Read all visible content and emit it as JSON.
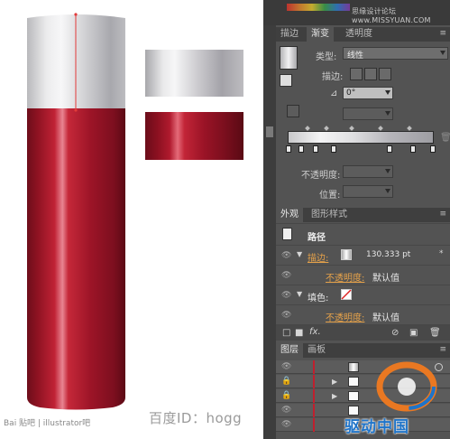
{
  "canvas": {
    "caption": "百度ID：hogg",
    "watermark": "Bai 贴吧 | illustrator吧"
  },
  "panel": {
    "site": "思缘设计论坛 www.MISSYUAN.COM",
    "gradient_tabs": [
      "描边",
      "渐变",
      "透明度"
    ],
    "active_gradient_tab": "渐变",
    "type_label": "类型:",
    "type_value": "线性",
    "stroke_label": "描边:",
    "angle_value": "0°",
    "opacity_label": "不透明度:",
    "position_label": "位置:",
    "appearance_tabs": [
      "外观",
      "图形样式"
    ],
    "active_appearance_tab": "外观",
    "path_label": "路径",
    "stroke_row_label": "描边:",
    "stroke_row_value": "130.333 pt",
    "opacity_row_label": "不透明度:",
    "opacity_row_value": "默认值",
    "fill_row_label": "填色:",
    "opacity_row2_label": "不透明度:",
    "opacity_row2_value": "默认值",
    "layers_tabs": [
      "图层",
      "画板"
    ],
    "active_layers_tab": "图层",
    "fx_label": "fx."
  },
  "overlay_logo": {
    "text": "驱动中国"
  },
  "colors": {
    "panel_bg": "#535353",
    "accent_orange": "#e6a24a",
    "bottle_red": "#9a1326",
    "logo_blue": "#1f74c9"
  }
}
